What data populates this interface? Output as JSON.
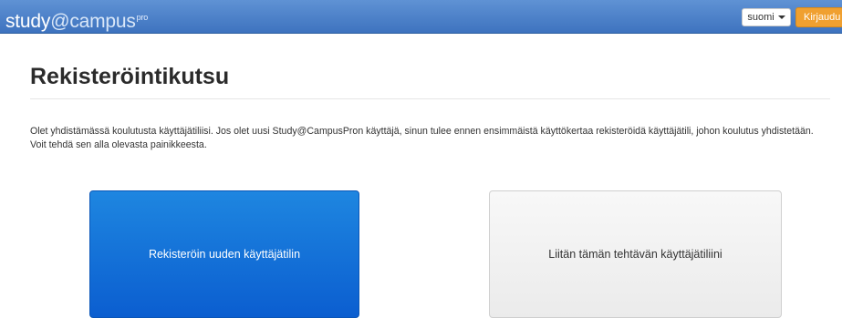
{
  "header": {
    "logo": {
      "main": "study",
      "at": "@campus",
      "sup": "pro"
    },
    "language_label": "suomi",
    "login_label": "Kirjaudu"
  },
  "main": {
    "title": "Rekisteröintikutsu",
    "intro_line1": "Olet yhdistämässä koulutusta käyttäjätiliisi. Jos olet uusi Study@CampusPron käyttäjä, sinun tulee ennen ensimmäistä käyttökertaa rekisteröidä käyttäjätili, johon koulutus yhdistetään.",
    "intro_line2": "Voit tehdä sen alla olevasta painikkeesta.",
    "register_button": "Rekisteröin uuden käyttäjätilin",
    "link_button": "Liitän tämän tehtävän käyttäjätiliini"
  },
  "colors": {
    "topbar": "#4a80c8",
    "login_accent": "#f0a030",
    "primary_button": "#0b6ed8"
  }
}
